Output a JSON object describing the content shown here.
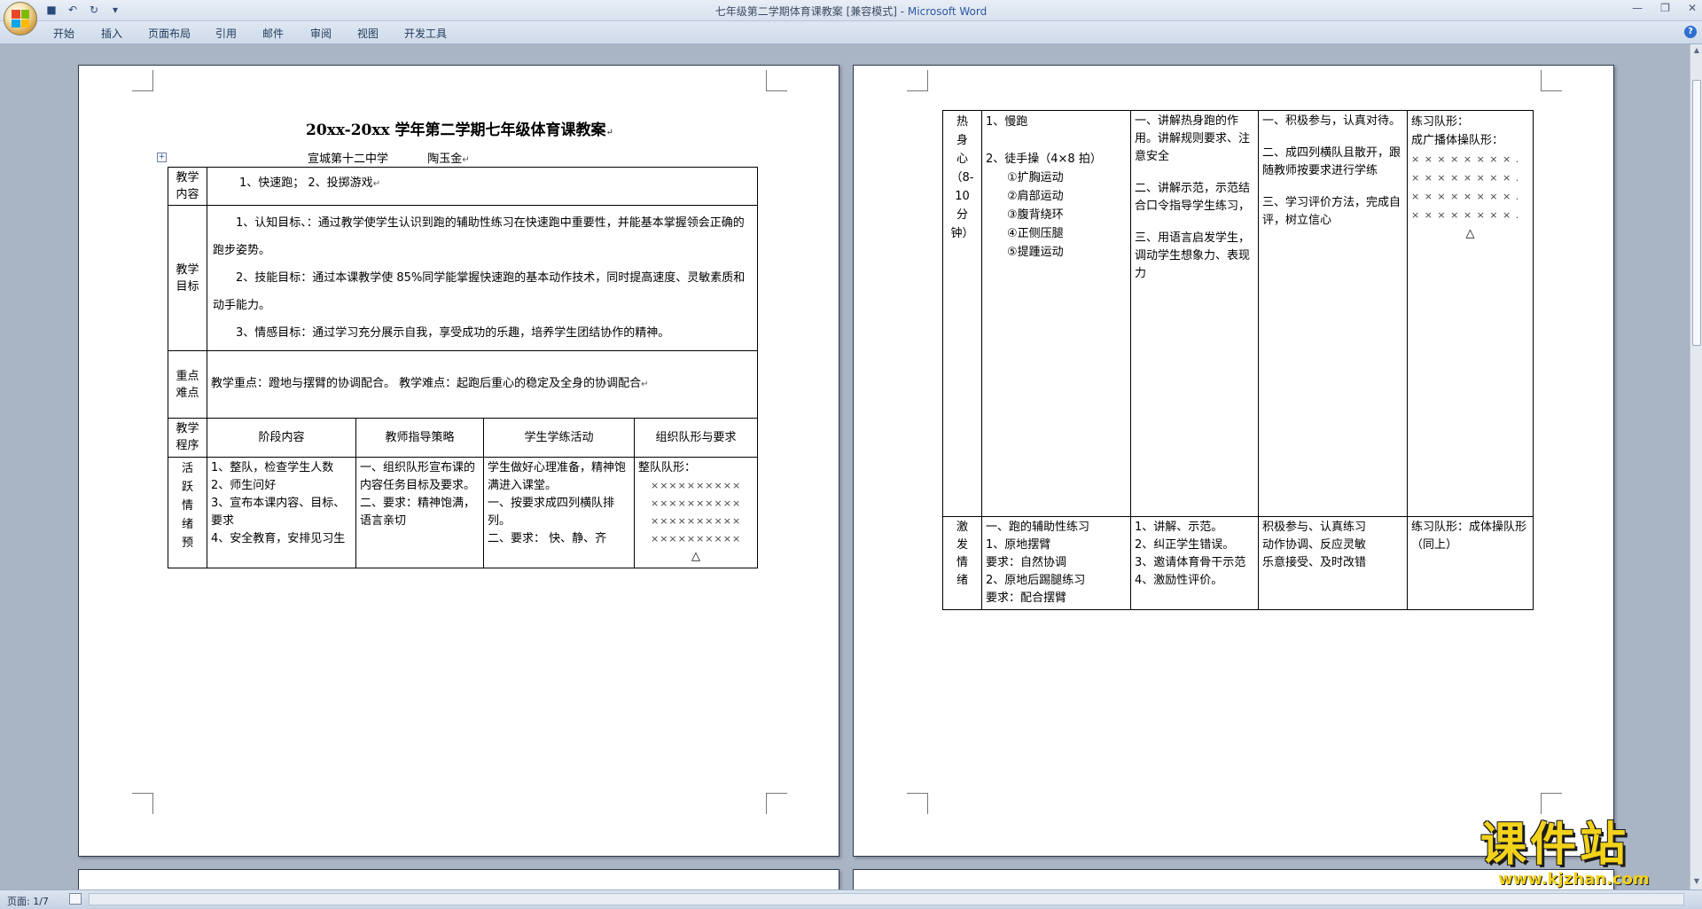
{
  "window": {
    "title": "七年级第二学期体育课教案 [兼容模式] - ",
    "app": "Microsoft Word",
    "qat": [
      "save-icon",
      "undo-icon",
      "redo-icon",
      "customize-icon"
    ]
  },
  "tabs": [
    "开始",
    "插入",
    "页面布局",
    "引用",
    "邮件",
    "审阅",
    "视图",
    "开发工具"
  ],
  "doc": {
    "title": "20xx-20xx 学年第二学期七年级体育课教案",
    "school": "宣城第十二中学",
    "teacher": "陶玉金",
    "content_label": "教学内容",
    "content_text": "1、快速跑；    2、投掷游戏",
    "goal_label": "教学目标",
    "goal_1": "1、认知目标、：通过教学使学生认识到跑的辅助性练习在快速跑中重要性，并能基本掌握领会正确的跑步姿势。",
    "goal_2": "2、技能目标：通过本课教学使 85%同学能掌握快速跑的基本动作技术，同时提高速度、灵敏素质和动手能力。",
    "goal_3": "3、情感目标：通过学习充分展示自我，享受成功的乐趣，培养学生团结协作的精神。",
    "key_label": "重点难点",
    "key_text": "教学重点：蹬地与摆臂的协调配合。 教学难点：起跑后重心的稳定及全身的协调配合",
    "proc_label": "教学程序",
    "headers": [
      "阶段内容",
      "教师指导策略",
      "学生学练活动",
      "组织队形与要求"
    ],
    "row1_label": "活跃情绪预",
    "row1_col1": [
      "1、整队，检查学生人数",
      "2、师生问好",
      "3、宣布本课内容、目标、要求",
      "4、安全教育，安排见习生"
    ],
    "row1_col2": [
      "一、组织队形宣布课的内容任务目标及要求。",
      "二、要求：精神饱满，语言亲切"
    ],
    "row1_col3": [
      "学生做好心理准备，精神饱满进入课堂。",
      "一、按要求成四列横队排列。",
      "二、要求： 快、静、齐"
    ],
    "row1_col4_title": "整队队形：",
    "row1_x": "××××××××××",
    "triangle": "△"
  },
  "doc2": {
    "row1_label": [
      "热",
      "身",
      "心",
      "（8-",
      "10",
      "分",
      "钟）"
    ],
    "row1_col1": [
      "1、慢跑",
      "2、徒手操（4×8 拍）",
      "①扩胸运动",
      "②肩部运动",
      "③腹背绕环",
      "④正侧压腿",
      "⑤提踵运动"
    ],
    "row1_col2": [
      "一、讲解热身跑的作用。讲解规则要求、注意安全",
      "二、讲解示范，示范结合口令指导学生练习，",
      "三、用语言启发学生，调动学生想象力、表现力"
    ],
    "row1_col3": [
      "一、积极参与，认真对待。",
      "二、成四列横队且散开，跟随教师按要求进行学练",
      "三、学习评价方法，完成自评，树立信心"
    ],
    "row1_col4": [
      "练习队形：",
      "成广播体操队形："
    ],
    "row1_x": "× × × × × × × × .",
    "row2_label": [
      "激",
      "发",
      "情",
      "绪"
    ],
    "row2_col1": [
      "一、跑的辅助性练习",
      "1、原地摆臂",
      "要求：自然协调",
      "2、原地后踢腿练习",
      "要求：配合摆臂"
    ],
    "row2_col2": [
      "1、讲解、示范。",
      "2、纠正学生错误。",
      "3、邀请体育骨干示范",
      "4、激励性评价。"
    ],
    "row2_col3": [
      "积极参与、认真练习",
      "动作协调、反应灵敏",
      "乐意接受、及时改错"
    ],
    "row2_col4": [
      "练习队形：成体操队形（同上）"
    ]
  },
  "status": {
    "page": "页面: 1/7"
  },
  "watermark": {
    "big": "课件站",
    "small": "www.kjzhan.com"
  },
  "colors": {
    "workspace": "#a9b4c4",
    "ribbon": "#dfe7f2",
    "title_accent": "#2c5aa0",
    "watermark": "#f2d21a"
  }
}
